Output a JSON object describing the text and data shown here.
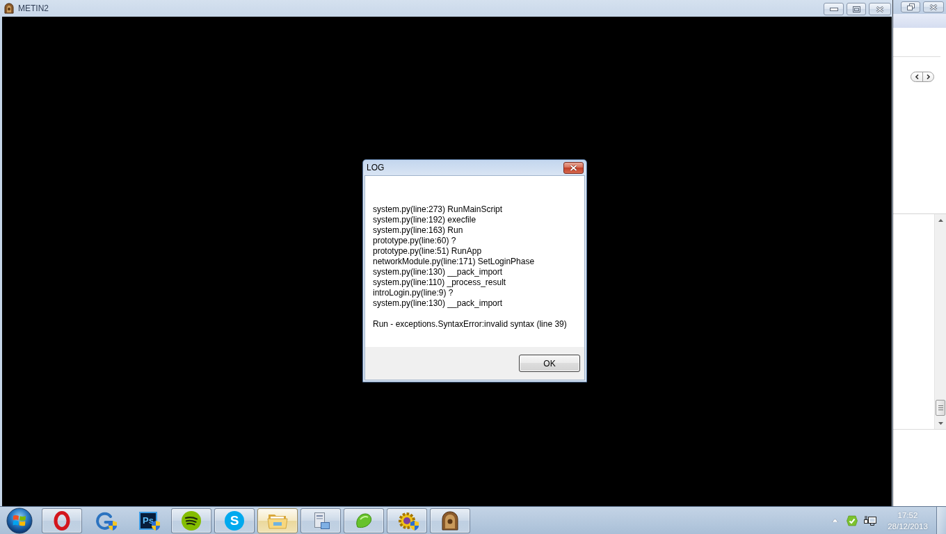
{
  "game_window": {
    "title": "METIN2"
  },
  "dialog": {
    "title": "LOG",
    "lines": [
      "system.py(line:273) RunMainScript",
      "system.py(line:192) execfile",
      "system.py(line:163) Run",
      "prototype.py(line:60) ?",
      "prototype.py(line:51) RunApp",
      "networkModule.py(line:171) SetLoginPhase",
      "system.py(line:130) __pack_import",
      "system.py(line:110) _process_result",
      "introLogin.py(line:9) ?",
      "system.py(line:130) __pack_import"
    ],
    "message": "Run - exceptions.SyntaxError:invalid syntax (line 39)",
    "button": "OK"
  },
  "taskbar": {
    "items": [
      {
        "kind": "ring",
        "open": true,
        "selected": false
      },
      {
        "kind": "arc",
        "open": false,
        "selected": false
      },
      {
        "kind": "tile",
        "label": "Ps",
        "open": false,
        "selected": false
      },
      {
        "kind": "waves",
        "open": true,
        "selected": false
      },
      {
        "kind": "disc",
        "label": "S",
        "open": true,
        "selected": false
      },
      {
        "kind": "folder",
        "open": true,
        "selected": true
      },
      {
        "kind": "computer",
        "open": true,
        "selected": false
      },
      {
        "kind": "leaf",
        "open": true,
        "selected": false
      },
      {
        "kind": "gear",
        "open": true,
        "selected": false
      },
      {
        "kind": "emblem",
        "open": true,
        "selected": false
      }
    ]
  },
  "tray": {
    "time": "17:52",
    "date": "28/12/2013"
  }
}
